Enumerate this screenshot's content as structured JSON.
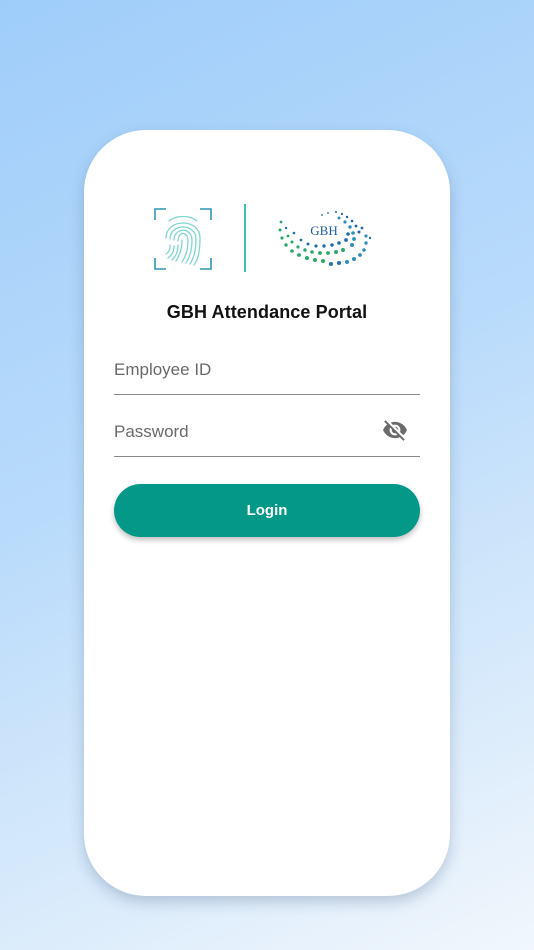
{
  "app": {
    "title": "GBH Attendance Portal",
    "brand_logo_text": "GBH"
  },
  "form": {
    "employee_id_placeholder": "Employee ID",
    "employee_id_value": "",
    "password_placeholder": "Password",
    "password_value": "",
    "password_toggle_icon": "eye-off-icon",
    "login_label": "Login"
  },
  "colors": {
    "accent": "#039887",
    "divider": "#3fbfae",
    "fingerprint": "#5bc3c8"
  }
}
